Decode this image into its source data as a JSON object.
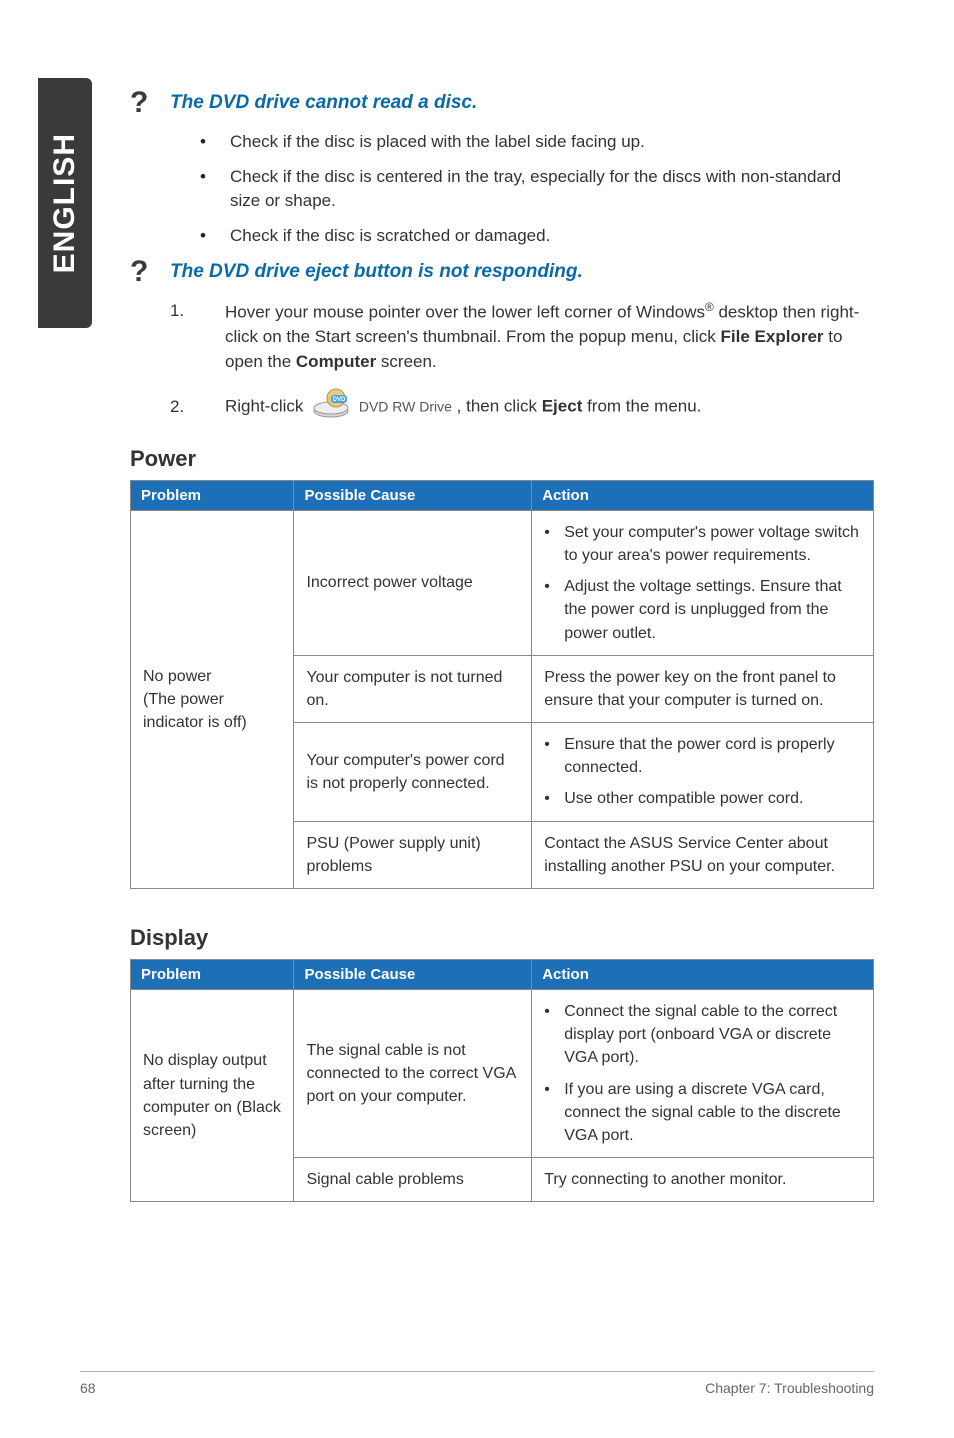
{
  "sideTab": "ENGLISH",
  "question1": {
    "title": "The DVD drive cannot read a disc.",
    "bullets": [
      "Check if the disc is placed with the label side facing up.",
      "Check if the disc is centered in the tray, especially for the discs with non-standard size or shape.",
      "Check if the disc is scratched or damaged."
    ]
  },
  "question2": {
    "title": "The DVD drive eject button is not responding.",
    "step1_pre": "Hover your mouse pointer over the lower left corner of Windows",
    "step1_reg": "®",
    "step1_mid": " desktop then right-click on the Start screen's thumbnail. From the popup menu, click ",
    "step1_file": "File Explorer",
    "step1_open": " to open the ",
    "step1_computer": "Computer",
    "step1_end": " screen.",
    "step2_pre": "Right-click ",
    "step2_drive": "DVD RW Drive",
    "step2_mid": ", then click ",
    "step2_eject": "Eject",
    "step2_end": " from the menu."
  },
  "powerSection": {
    "heading": "Power",
    "headers": {
      "problem": "Problem",
      "cause": "Possible Cause",
      "action": "Action"
    },
    "problem": "No power\n(The power indicator is off)",
    "rows": [
      {
        "cause": "Incorrect power voltage",
        "actions": [
          "Set your computer's power voltage switch to your area's power requirements.",
          "Adjust the voltage settings. Ensure that the power cord is unplugged from the power outlet."
        ]
      },
      {
        "cause": "Your computer is not turned on.",
        "actionText": "Press the power key on the front panel to ensure that your computer is turned on."
      },
      {
        "cause": "Your computer's power cord is not properly connected.",
        "actions": [
          "Ensure that the power cord is properly connected.",
          "Use other compatible power cord."
        ]
      },
      {
        "cause": "PSU (Power supply unit) problems",
        "actionText": "Contact the ASUS Service Center about installing another PSU on your computer."
      }
    ]
  },
  "displaySection": {
    "heading": "Display",
    "headers": {
      "problem": "Problem",
      "cause": "Possible Cause",
      "action": "Action"
    },
    "problem": "No display output after turning the computer on (Black screen)",
    "rows": [
      {
        "cause": "The signal cable is not connected to the correct VGA port on your computer.",
        "actions": [
          "Connect the signal cable to the correct display port (onboard VGA or discrete VGA port).",
          "If you are using a discrete VGA card, connect the signal cable to the discrete VGA port."
        ]
      },
      {
        "cause": "Signal cable problems",
        "actionText": "Try connecting to another monitor."
      }
    ]
  },
  "footer": {
    "page": "68",
    "chapter": "Chapter 7: Troubleshooting"
  }
}
